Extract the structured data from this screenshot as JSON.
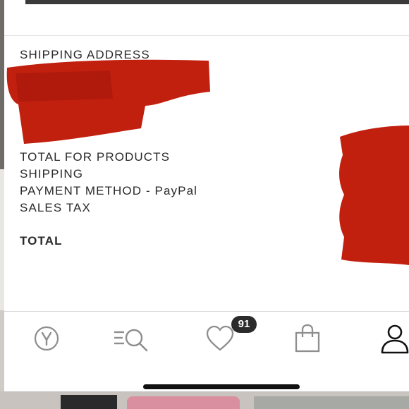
{
  "summary": {
    "shipping_address_label": "SHIPPING ADDRESS",
    "total_for_products_label": "TOTAL FOR PRODUCTS",
    "shipping_label": "SHIPPING",
    "payment_method_label": "PAYMENT METHOD - PayPal",
    "sales_tax_label": "SALES TAX",
    "total_label": "TOTAL"
  },
  "tab_bar": {
    "tabs": [
      {
        "icon": "brand-logo-icon"
      },
      {
        "icon": "search-icon"
      },
      {
        "icon": "heart-icon",
        "badge": "91"
      },
      {
        "icon": "shopping-bag-icon"
      },
      {
        "icon": "profile-icon"
      }
    ],
    "active_tab": "profile"
  },
  "colors": {
    "redaction": "#c1200f",
    "text": "#2a2a2a",
    "icon_inactive": "#8e8e8e",
    "icon_active": "#111111"
  }
}
